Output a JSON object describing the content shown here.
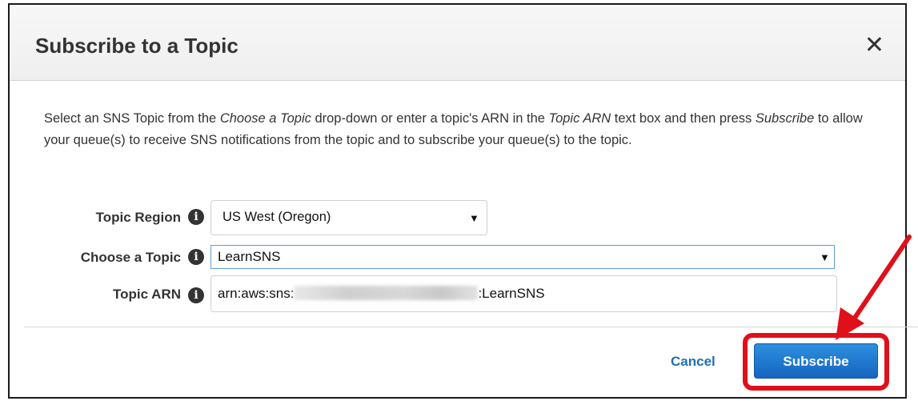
{
  "dialog": {
    "title": "Subscribe to a Topic",
    "close_symbol": "✕"
  },
  "description": {
    "part1": "Select an SNS Topic from the ",
    "choose_topic": "Choose a Topic",
    "part2": " drop-down or enter a topic's ARN in the ",
    "topic_arn": "Topic ARN",
    "part3": " text box and then press ",
    "subscribe": "Subscribe",
    "part4": " to allow your queue(s) to receive SNS notifications from the topic and to subscribe your queue(s) to the topic."
  },
  "form": {
    "region_label": "Topic Region",
    "region_value": "US West (Oregon)",
    "topic_label": "Choose a Topic",
    "topic_value": "LearnSNS",
    "arn_label": "Topic ARN",
    "arn_prefix": "arn:aws:sns:",
    "arn_suffix": ":LearnSNS",
    "info_glyph": "i",
    "caret_glyph": "▼"
  },
  "footer": {
    "cancel_label": "Cancel",
    "subscribe_label": "Subscribe"
  },
  "icons": {
    "info": "info-circle-icon",
    "close": "close-icon",
    "dropdown": "chevron-down-icon"
  },
  "colors": {
    "primary": "#1f6fb5",
    "highlight": "#e0101a"
  }
}
